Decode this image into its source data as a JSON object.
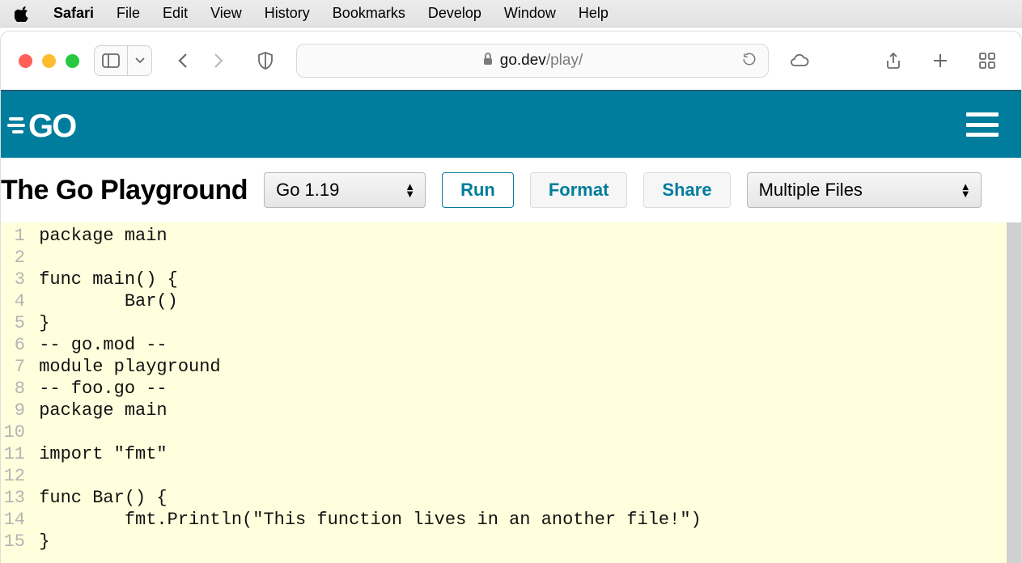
{
  "menubar": {
    "app": "Safari",
    "items": [
      "File",
      "Edit",
      "View",
      "History",
      "Bookmarks",
      "Develop",
      "Window",
      "Help"
    ]
  },
  "browser": {
    "url_host": "go.dev",
    "url_path": "/play/"
  },
  "go_header": {
    "logo_text": "GO"
  },
  "toolbar": {
    "title": "The Go Playground",
    "version_selected": "Go 1.19",
    "run_label": "Run",
    "format_label": "Format",
    "share_label": "Share",
    "mode_selected": "Multiple Files"
  },
  "code_lines": [
    "package main",
    "",
    "func main() {",
    "        Bar()",
    "}",
    "-- go.mod --",
    "module playground",
    "-- foo.go --",
    "package main",
    "",
    "import \"fmt\"",
    "",
    "func Bar() {",
    "        fmt.Println(\"This function lives in an another file!\")",
    "}"
  ]
}
